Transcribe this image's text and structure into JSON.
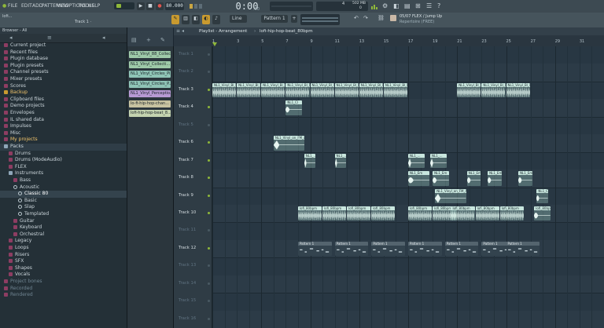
{
  "colors": {
    "accent": "#8fb83a",
    "audio_clip": "#9cc9bd",
    "audio_clip_header": "#c8e6de",
    "pattern_clip": "#3a4a55"
  },
  "menu": {
    "items": [
      "FILE",
      "EDIT",
      "ADD",
      "PATTERNS",
      "VIEW",
      "OPTIONS",
      "TOOLS",
      "HELP"
    ]
  },
  "hint": {
    "line1": "lofi...",
    "line2": "Track 1 ·"
  },
  "transport": {
    "tempo": "80.000",
    "time": "0:00",
    "time_sub": ":00",
    "pattern": "Pattern 1",
    "snap": "Line",
    "cpu": "4",
    "ram": "502 MB",
    "polyphony": "0"
  },
  "news": {
    "title": "05/07  FLEX / Jump Up",
    "subtitle": "Repertoire (FREE)"
  },
  "browser": {
    "header": "Browser - All",
    "items": [
      {
        "label": "Current project",
        "icon": "folder"
      },
      {
        "label": "Recent files",
        "icon": "folder"
      },
      {
        "label": "Plugin database",
        "icon": "folder"
      },
      {
        "label": "Plugin presets",
        "icon": "folder"
      },
      {
        "label": "Channel presets",
        "icon": "folder"
      },
      {
        "label": "Mixer presets",
        "icon": "folder"
      },
      {
        "label": "Scores",
        "icon": "folder"
      },
      {
        "label": "Backup",
        "icon": "folder-accent"
      },
      {
        "label": "Clipboard files",
        "icon": "folder"
      },
      {
        "label": "Demo projects",
        "icon": "folder"
      },
      {
        "label": "Envelopes",
        "icon": "folder"
      },
      {
        "label": "IL shared data",
        "icon": "folder"
      },
      {
        "label": "Impulses",
        "icon": "folder"
      },
      {
        "label": "Misc",
        "icon": "folder"
      },
      {
        "label": "My projects",
        "icon": "folder"
      },
      {
        "label": "Packs",
        "icon": "folder-open"
      },
      {
        "label": "Drums",
        "icon": "folder",
        "indent": 1
      },
      {
        "label": "Drums (ModeAudio)",
        "icon": "folder",
        "indent": 1
      },
      {
        "label": "FLEX",
        "icon": "folder",
        "indent": 1
      },
      {
        "label": "Instruments",
        "icon": "folder-open",
        "indent": 1
      },
      {
        "label": "Bass",
        "icon": "folder",
        "indent": 2
      },
      {
        "label": "Acoustic",
        "icon": "circle",
        "indent": 2
      },
      {
        "label": "Classic 80",
        "icon": "circle",
        "indent": 3
      },
      {
        "label": "Basic",
        "icon": "circle",
        "indent": 3
      },
      {
        "label": "Slap",
        "icon": "circle",
        "indent": 3
      },
      {
        "label": "Templated",
        "icon": "circle",
        "indent": 3
      },
      {
        "label": "Guitar",
        "icon": "folder",
        "indent": 2
      },
      {
        "label": "Keyboard",
        "icon": "folder",
        "indent": 2
      },
      {
        "label": "Orchestral",
        "icon": "folder",
        "indent": 2
      },
      {
        "label": "Legacy",
        "icon": "folder",
        "indent": 1
      },
      {
        "label": "Loops",
        "icon": "folder",
        "indent": 1
      },
      {
        "label": "Risers",
        "icon": "folder",
        "indent": 1
      },
      {
        "label": "SFX",
        "icon": "folder",
        "indent": 1
      },
      {
        "label": "Shapes",
        "icon": "folder",
        "indent": 1
      },
      {
        "label": "Vocals",
        "icon": "folder",
        "indent": 1
      },
      {
        "label": "Project bones",
        "icon": "folder"
      },
      {
        "label": "Recorded",
        "icon": "folder"
      },
      {
        "label": "Rendered",
        "icon": "folder"
      }
    ]
  },
  "channel_clips": [
    {
      "label": "NL1_Vinyl_88_Collec...",
      "color": "#9ec9a8"
    },
    {
      "label": "NL1_Vinyl_Collecti...",
      "color": "#9ec9a8"
    },
    {
      "label": "NL1_Vinyl_Circles_Pi...",
      "color": "#8fc4b6"
    },
    {
      "label": "NL1_Vinyl_Circles_P...",
      "color": "#8fc4b6"
    },
    {
      "label": "NL1_Vinyl_Perceptio...",
      "color": "#b79ad4"
    },
    {
      "label": "lo-fi-hip-hop-chan...",
      "color": "#c7c2a0"
    },
    {
      "label": "lofi-hip-hop-beat_8...",
      "color": "#c4d3b0"
    }
  ],
  "playlist": {
    "title": "Playlist - Arrangement",
    "arrangement": "lofi-hip-hop-beat_80bpm"
  },
  "ruler": {
    "marks": [
      "1",
      "3",
      "5",
      "7",
      "9",
      "11",
      "13",
      "15",
      "17",
      "19",
      "21",
      "23",
      "25",
      "27",
      "29",
      "31"
    ]
  },
  "tracks": [
    {
      "name": "Track 1",
      "active": false
    },
    {
      "name": "Track 2",
      "active": false
    },
    {
      "name": "Track 3",
      "active": true
    },
    {
      "name": "Track 4",
      "active": true
    },
    {
      "name": "Track 5",
      "active": false
    },
    {
      "name": "Track 6",
      "active": true
    },
    {
      "name": "Track 7",
      "active": true
    },
    {
      "name": "Track 8",
      "active": true
    },
    {
      "name": "Track 9",
      "active": true
    },
    {
      "name": "Track 10",
      "active": true
    },
    {
      "name": "Track 11",
      "active": false
    },
    {
      "name": "Track 12",
      "active": true
    },
    {
      "name": "Track 13",
      "active": false
    },
    {
      "name": "Track 14",
      "active": false
    },
    {
      "name": "Track 15",
      "active": false
    },
    {
      "name": "Track 16",
      "active": false
    }
  ],
  "clip_labels": {
    "piano": "NL1_Vinyl_Bl_lon_Piano_lon",
    "pling": "NL1_Em",
    "pad": "NL1_Vinyl_on_FM_Am",
    "short": "NL1_Cl",
    "short_b": "NL1_...",
    "vinyl": "lofi_80bpm",
    "pattern": "Pattern 1"
  }
}
